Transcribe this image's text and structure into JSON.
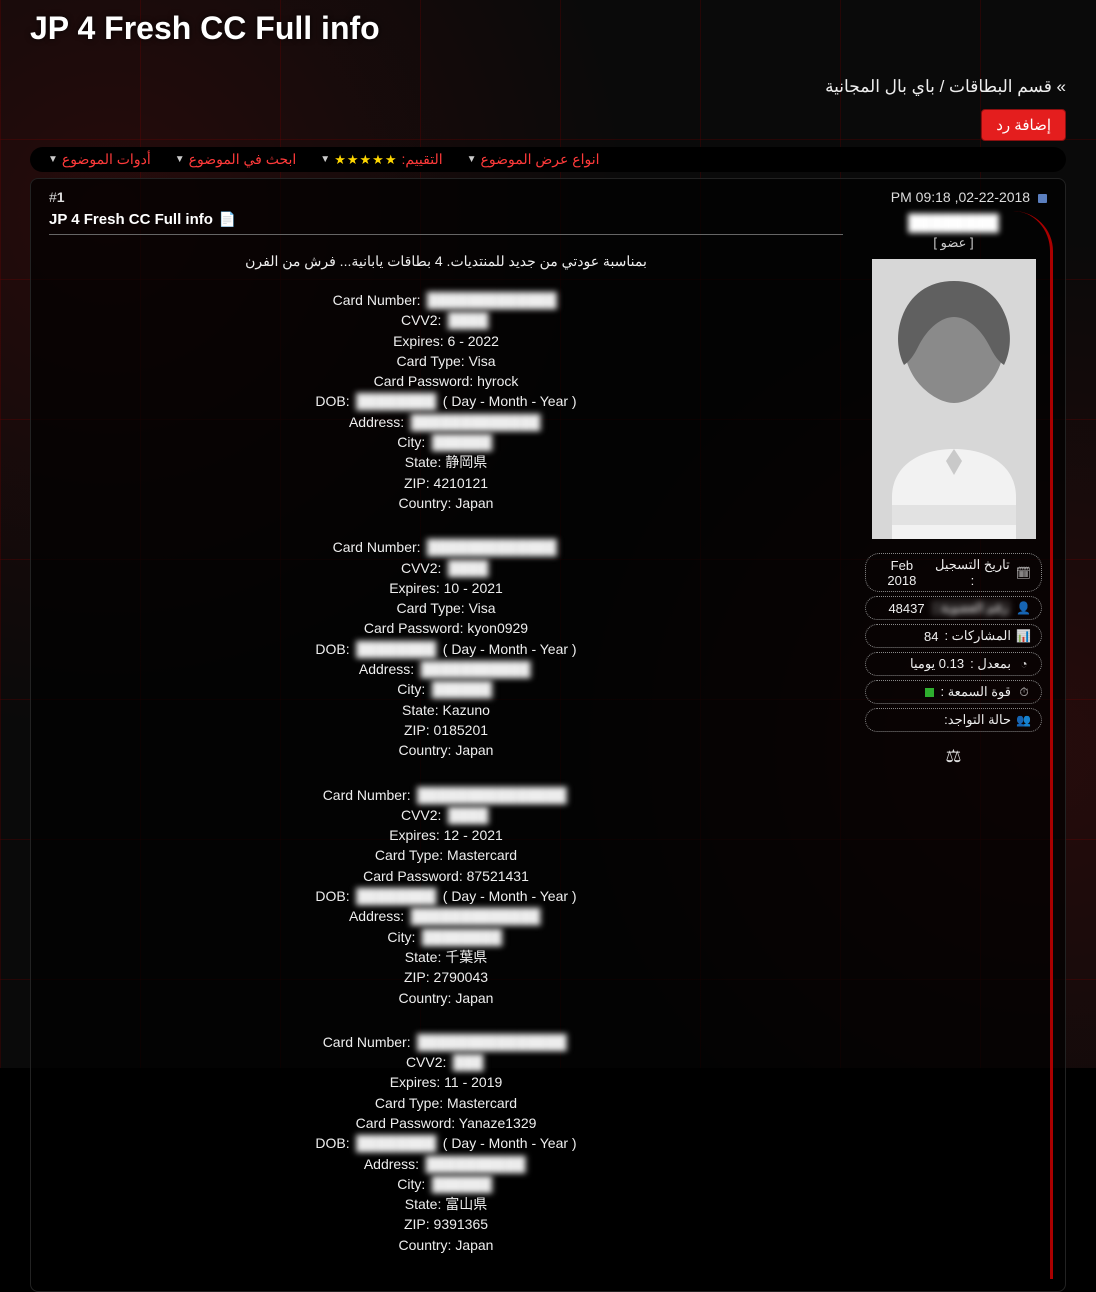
{
  "title": "JP 4 Fresh CC Full info",
  "breadcrumb": "» قسم البطاقات / باي بال المجانية",
  "reply_button": "إضافة رد",
  "toolbar": {
    "tools": "أدوات الموضوع",
    "search": "ابحث في الموضوع",
    "rating_label": "التقييم:",
    "display": "انواع عرض الموضوع",
    "stars": "★★★★★"
  },
  "post_header": {
    "timestamp": "02-22-2018, 09:18 PM",
    "post_number": "#1"
  },
  "user": {
    "name": "████████",
    "rank": "[ عضو ]",
    "stats": {
      "join_label": "تاريخ التسجيل :",
      "join_value": "Feb 2018",
      "id_label": "رقم العضوية :",
      "id_value": "48437",
      "posts_label": "المشاركات :",
      "posts_value": "84",
      "rate_label": "بمعدل :",
      "rate_value": "0.13 يوميا",
      "rep_label": "قوة السمعة :",
      "presence_label": "حالة التواجد:"
    }
  },
  "content": {
    "thread_title": "JP 4 Fresh CC Full info",
    "intro": "بمناسبة عودتي من جديد للمنتديات. 4 بطاقات يابانية... فرش من الفرن",
    "cards": [
      {
        "number": "█████████████",
        "cvv": "████",
        "expires": "6 - 2022",
        "type": "Visa",
        "password": "hyrock",
        "dob": "████████",
        "dob_suffix": "( Day - Month - Year )",
        "address": "█████████████",
        "city": "██████",
        "state": "静岡県",
        "zip": "4210121",
        "country": "Japan"
      },
      {
        "number": "█████████████",
        "cvv": "████",
        "expires": "10 - 2021",
        "type": "Visa",
        "password": "kyon0929",
        "dob": "████████",
        "dob_suffix": "( Day - Month - Year )",
        "address": "███████████",
        "city": "██████",
        "state": "Kazuno",
        "zip": "0185201",
        "country": "Japan"
      },
      {
        "number": "███████████████",
        "cvv": "████",
        "expires": "12 - 2021",
        "type": "Mastercard",
        "password": "87521431",
        "dob": "████████",
        "dob_suffix": "( Day - Month - Year )",
        "address": "█████████████",
        "city": "████████",
        "state": "千葉県",
        "zip": "2790043",
        "country": "Japan"
      },
      {
        "number": "███████████████",
        "cvv": "███",
        "expires": "11 - 2019",
        "type": "Mastercard",
        "password": "Yanaze1329",
        "dob": "████████",
        "dob_suffix": "( Day - Month - Year )",
        "address": "██████████",
        "city": "██████",
        "state": "富山県",
        "zip": "9391365",
        "country": "Japan"
      }
    ]
  }
}
